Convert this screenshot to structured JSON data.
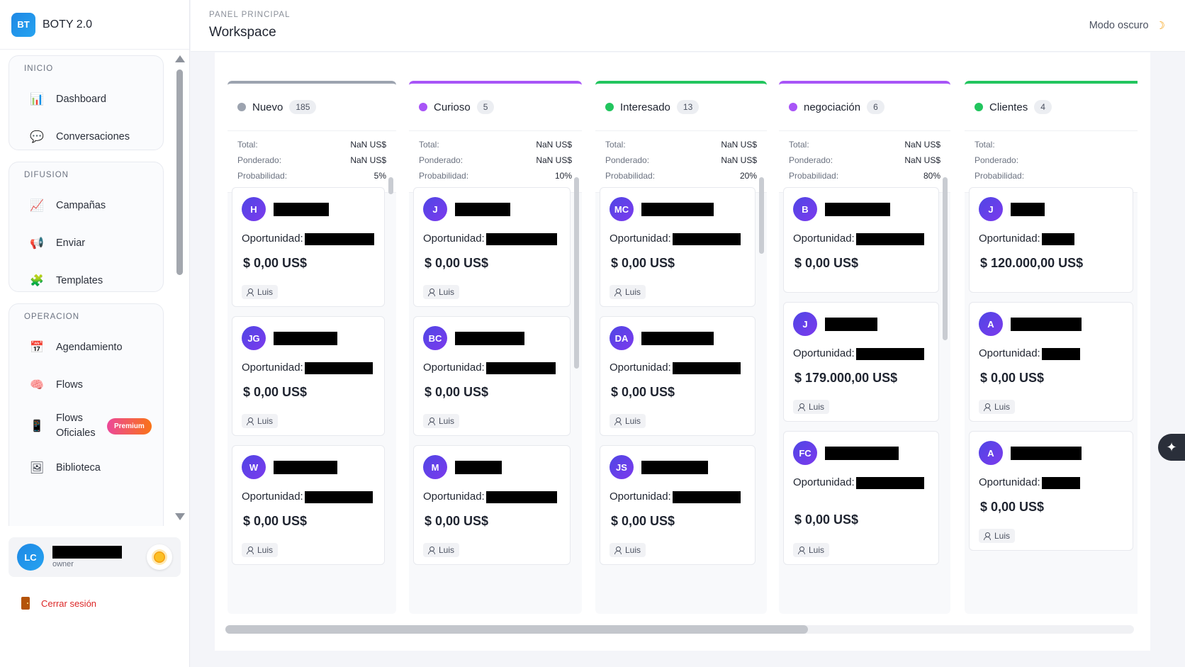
{
  "app": {
    "logo": "BT",
    "name": "BOTY 2.0"
  },
  "header": {
    "breadcrumb": "PANEL PRINCIPAL",
    "title": "Workspace",
    "mode_label": "Modo oscuro",
    "mode_icon": "☽"
  },
  "sidebar": {
    "groups": [
      {
        "title": "INICIO",
        "items": [
          {
            "label": "Dashboard",
            "icon": "📊"
          },
          {
            "label": "Conversaciones",
            "icon": "💬"
          }
        ]
      },
      {
        "title": "DIFUSION",
        "items": [
          {
            "label": "Campañas",
            "icon": "📈"
          },
          {
            "label": "Enviar",
            "icon": "📢"
          },
          {
            "label": "Templates",
            "icon": "🧩"
          }
        ]
      },
      {
        "title": "OPERACION",
        "items": [
          {
            "label": "Agendamiento",
            "icon": "📅"
          },
          {
            "label": "Flows",
            "icon": "🧠"
          },
          {
            "label": "Flows Oficiales",
            "icon": "📱",
            "badge": "Premium"
          },
          {
            "label": "Biblioteca",
            "icon": "🖼"
          }
        ]
      }
    ]
  },
  "user": {
    "initials": "LC",
    "role": "owner"
  },
  "logout_label": "Cerrar sesión",
  "stats_labels": {
    "total": "Total:",
    "weighted": "Ponderado:",
    "probability": "Probabilidad:"
  },
  "card_labels": {
    "opportunity": "Oportunidad:"
  },
  "ai_icon": "✦",
  "columns": [
    {
      "title": "Nuevo",
      "count": "185",
      "color": "#9ca3af",
      "dot": "#9ca3af",
      "total": "NaN US$",
      "weighted": "NaN US$",
      "probability": "5%",
      "cards": [
        {
          "initials": "H",
          "amount": "$  0,00 US$",
          "owner": "Luis"
        },
        {
          "initials": "JG",
          "amount": "$  0,00 US$",
          "owner": "Luis"
        },
        {
          "initials": "W",
          "amount": "$  0,00 US$",
          "owner": "Luis"
        }
      ]
    },
    {
      "title": "Curioso",
      "count": "5",
      "color": "#a855f7",
      "dot": "#a855f7",
      "total": "NaN US$",
      "weighted": "NaN US$",
      "probability": "10%",
      "cards": [
        {
          "initials": "J",
          "amount": "$  0,00 US$",
          "owner": "Luis"
        },
        {
          "initials": "BC",
          "amount": "$  0,00 US$",
          "owner": "Luis"
        },
        {
          "initials": "M",
          "amount": "$  0,00 US$",
          "owner": "Luis"
        }
      ]
    },
    {
      "title": "Interesado",
      "count": "13",
      "color": "#22c55e",
      "dot": "#22c55e",
      "total": "NaN US$",
      "weighted": "NaN US$",
      "probability": "20%",
      "cards": [
        {
          "initials": "MC",
          "amount": "$  0,00 US$",
          "owner": "Luis"
        },
        {
          "initials": "DA",
          "amount": "$  0,00 US$",
          "owner": "Luis"
        },
        {
          "initials": "JS",
          "amount": "$  0,00 US$",
          "owner": "Luis"
        }
      ]
    },
    {
      "title": "negociación",
      "count": "6",
      "color": "#a855f7",
      "dot": "#a855f7",
      "total": "NaN US$",
      "weighted": "NaN US$",
      "probability": "80%",
      "cards": [
        {
          "initials": "B",
          "amount": "$  0,00 US$",
          "owner": ""
        },
        {
          "initials": "J",
          "amount": "$  179.000,00 US$",
          "owner": "Luis"
        },
        {
          "initials": "FC",
          "amount": "$  0,00 US$",
          "owner": "Luis"
        }
      ]
    },
    {
      "title": "Clientes",
      "count": "4",
      "color": "#22c55e",
      "dot": "#22c55e",
      "total": "",
      "weighted": "",
      "probability": "",
      "cards": [
        {
          "initials": "J",
          "amount": "$  120.000,00 US$",
          "owner": ""
        },
        {
          "initials": "A",
          "amount": "$  0,00 US$",
          "owner": "Luis"
        },
        {
          "initials": "A",
          "amount": "$  0,00 US$",
          "owner": "Luis"
        }
      ]
    }
  ]
}
